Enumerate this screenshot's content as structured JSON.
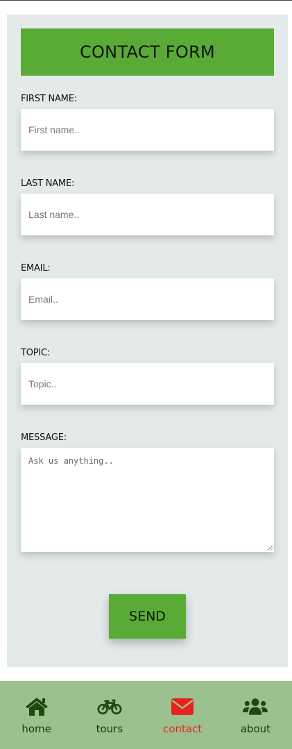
{
  "form": {
    "title": "CONTACT FORM",
    "fields": [
      {
        "label": "FIRST NAME:",
        "placeholder": "First name.."
      },
      {
        "label": "LAST NAME:",
        "placeholder": "Last name.."
      },
      {
        "label": "EMAIL:",
        "placeholder": "Email.."
      },
      {
        "label": "TOPIC:",
        "placeholder": "Topic.."
      }
    ],
    "message": {
      "label": "MESSAGE:",
      "placeholder": "Ask us anything.."
    },
    "send_label": "SEND"
  },
  "nav": {
    "items": [
      {
        "label": "home",
        "icon": "home-icon"
      },
      {
        "label": "tours",
        "icon": "bicycle-icon"
      },
      {
        "label": "contact",
        "icon": "envelope-icon",
        "active": true
      },
      {
        "label": "about",
        "icon": "users-icon"
      }
    ]
  },
  "colors": {
    "accent_green": "#5aab35",
    "nav_background": "#9bc18f",
    "nav_icon": "#1e4a0f",
    "active": "#e8231f",
    "card_background": "#e4eaea"
  }
}
